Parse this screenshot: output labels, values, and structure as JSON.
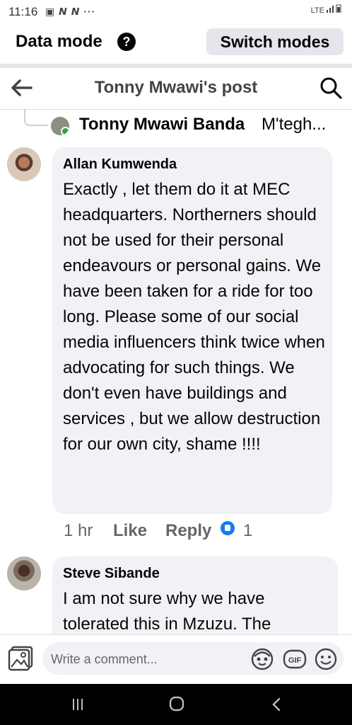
{
  "status_bar": {
    "time": "11:16",
    "notification_icons": "▣ 𝙉 𝙉 ···",
    "network": "LTE"
  },
  "data_mode": {
    "title": "Data mode",
    "help": "?",
    "switch_label": "Switch modes"
  },
  "header": {
    "title": "Tonny Mwawi's post"
  },
  "parent_comment": {
    "name": "Tonny Mwawi Banda",
    "snippet": "M'tegh..."
  },
  "comments": [
    {
      "author": "Allan Kumwenda",
      "text": "Exactly , let them do it at MEC headquarters. Northerners should not be used for their personal endeavours or personal gains. We have been taken for a ride for too long. Please some of our social media influencers think twice when advocating for such things. We don't even have buildings and services , but we allow destruction for our own city, shame !!!!",
      "time": "1 hr",
      "like_label": "Like",
      "reply_label": "Reply",
      "reactions": "1"
    },
    {
      "author": "Steve Sibande",
      "text": "I am not sure why we have tolerated this in Mzuzu. The"
    }
  ],
  "composer": {
    "placeholder": "Write a comment..."
  },
  "icons": [
    "back-arrow",
    "search",
    "photo",
    "avatar-sticker",
    "gif",
    "emoji",
    "like-reaction",
    "recent-apps",
    "home",
    "back"
  ],
  "colors": {
    "accent": "#1877f2",
    "bubble": "#f0f2f5",
    "online": "#31a24c"
  }
}
